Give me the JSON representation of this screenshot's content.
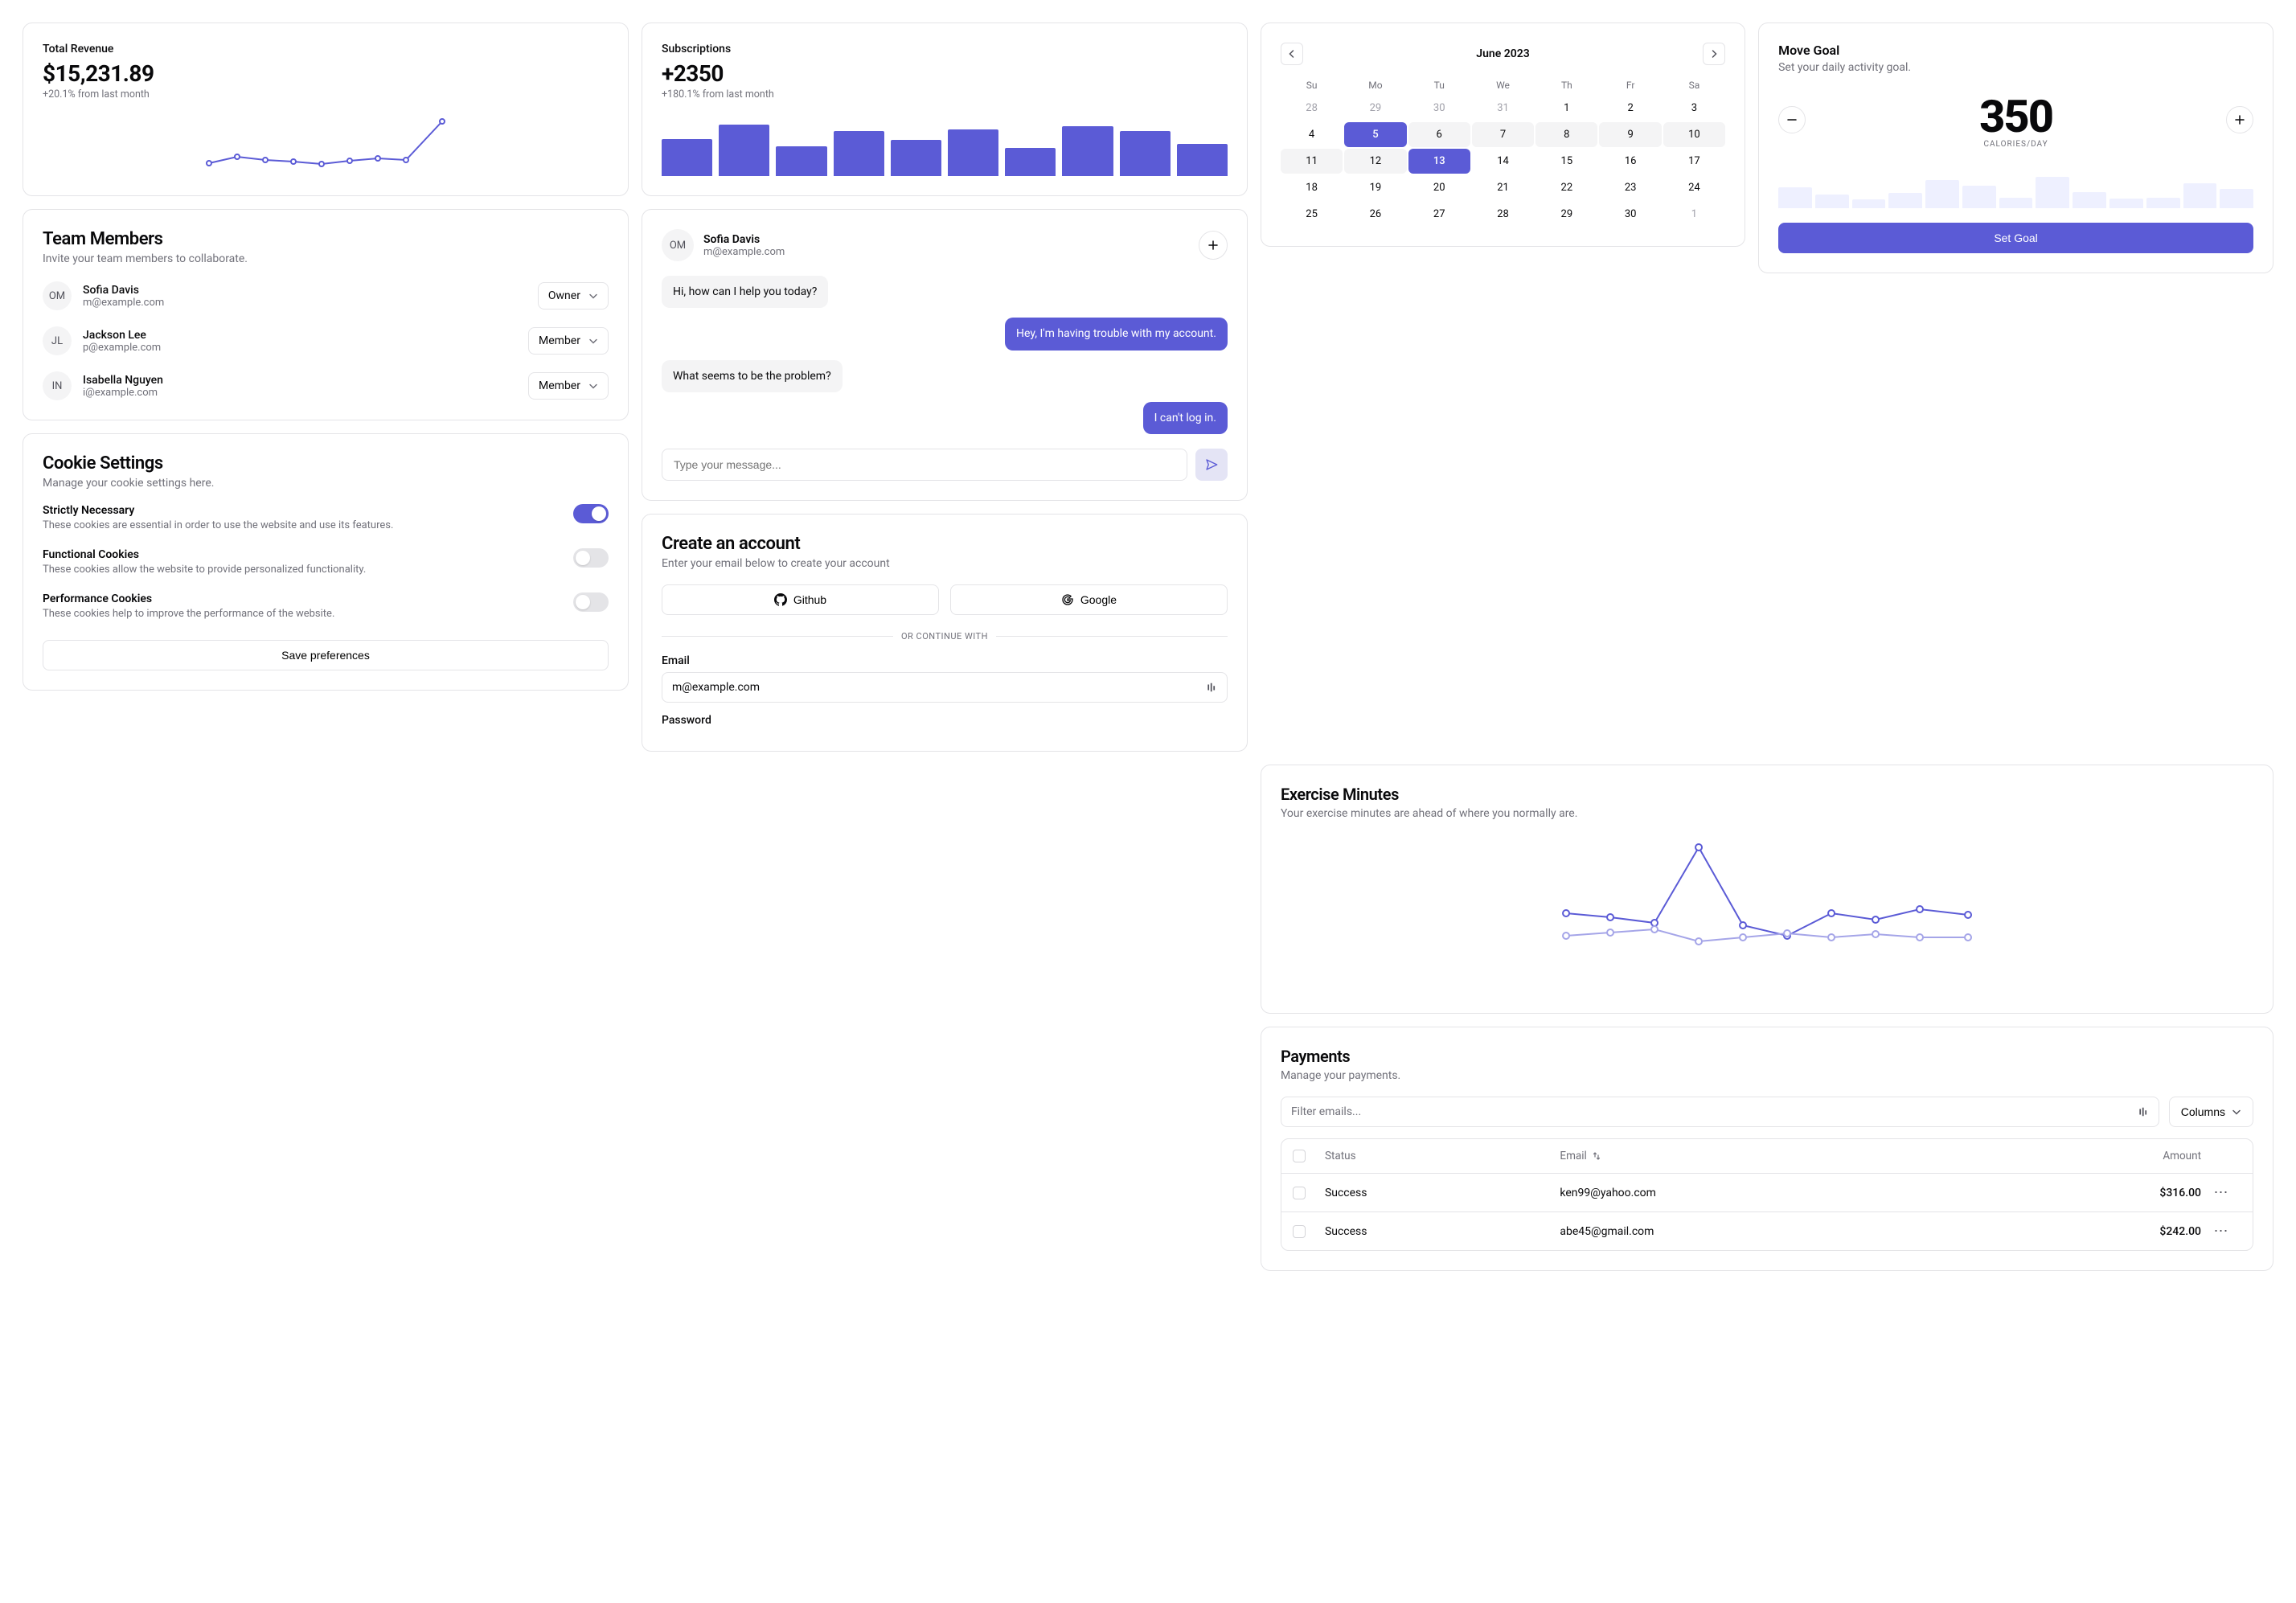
{
  "revenue": {
    "title": "Total Revenue",
    "value": "$15,231.89",
    "change": "+20.1% from last month"
  },
  "subscriptions": {
    "title": "Subscriptions",
    "value": "+2350",
    "change": "+180.1% from last month"
  },
  "team": {
    "title": "Team Members",
    "desc": "Invite your team members to collaborate.",
    "members": [
      {
        "initials": "OM",
        "name": "Sofia Davis",
        "email": "m@example.com",
        "role": "Owner"
      },
      {
        "initials": "JL",
        "name": "Jackson Lee",
        "email": "p@example.com",
        "role": "Member"
      },
      {
        "initials": "IN",
        "name": "Isabella Nguyen",
        "email": "i@example.com",
        "role": "Member"
      }
    ]
  },
  "cookies": {
    "title": "Cookie Settings",
    "desc": "Manage your cookie settings here.",
    "items": [
      {
        "title": "Strictly Necessary",
        "desc": "These cookies are essential in order to use the website and use its features.",
        "on": true
      },
      {
        "title": "Functional Cookies",
        "desc": "These cookies allow the website to provide personalized functionality.",
        "on": false
      },
      {
        "title": "Performance Cookies",
        "desc": "These cookies help to improve the performance of the website.",
        "on": false
      }
    ],
    "save_label": "Save preferences"
  },
  "chat": {
    "initials": "OM",
    "name": "Sofia Davis",
    "email": "m@example.com",
    "messages": [
      {
        "who": "them",
        "text": "Hi, how can I help you today?"
      },
      {
        "who": "me",
        "text": "Hey, I'm having trouble with my account."
      },
      {
        "who": "them",
        "text": "What seems to be the problem?"
      },
      {
        "who": "me",
        "text": "I can't log in."
      }
    ],
    "placeholder": "Type your message..."
  },
  "account": {
    "title": "Create an account",
    "desc": "Enter your email below to create your account",
    "github": "Github",
    "google": "Google",
    "divider": "OR CONTINUE WITH",
    "email_label": "Email",
    "email_value": "m@example.com",
    "password_label": "Password"
  },
  "calendar": {
    "title": "June 2023",
    "dow": [
      "Su",
      "Mo",
      "Tu",
      "We",
      "Th",
      "Fr",
      "Sa"
    ],
    "days": [
      {
        "n": 28,
        "m": true
      },
      {
        "n": 29,
        "m": true
      },
      {
        "n": 30,
        "m": true
      },
      {
        "n": 31,
        "m": true
      },
      {
        "n": 1
      },
      {
        "n": 2
      },
      {
        "n": 3
      },
      {
        "n": 4
      },
      {
        "n": 5,
        "sel": true
      },
      {
        "n": 6,
        "r": true
      },
      {
        "n": 7,
        "r": true
      },
      {
        "n": 8,
        "r": true
      },
      {
        "n": 9,
        "r": true
      },
      {
        "n": 10,
        "r": true
      },
      {
        "n": 11,
        "r": true
      },
      {
        "n": 12,
        "r": true
      },
      {
        "n": 13,
        "sel": true
      },
      {
        "n": 14
      },
      {
        "n": 15
      },
      {
        "n": 16
      },
      {
        "n": 17
      },
      {
        "n": 18
      },
      {
        "n": 19
      },
      {
        "n": 20
      },
      {
        "n": 21
      },
      {
        "n": 22
      },
      {
        "n": 23
      },
      {
        "n": 24
      },
      {
        "n": 25
      },
      {
        "n": 26
      },
      {
        "n": 27
      },
      {
        "n": 28
      },
      {
        "n": 29
      },
      {
        "n": 30
      },
      {
        "n": 1,
        "m": true
      }
    ]
  },
  "goal": {
    "title": "Move Goal",
    "desc": "Set your daily activity goal.",
    "value": "350",
    "unit": "CALORIES/DAY",
    "button": "Set Goal"
  },
  "exercise": {
    "title": "Exercise Minutes",
    "desc": "Your exercise minutes are ahead of where you normally are."
  },
  "payments": {
    "title": "Payments",
    "desc": "Manage your payments.",
    "filter_placeholder": "Filter emails...",
    "columns_label": "Columns",
    "headers": {
      "status": "Status",
      "email": "Email",
      "amount": "Amount"
    },
    "rows": [
      {
        "status": "Success",
        "email": "ken99@yahoo.com",
        "amount": "$316.00"
      },
      {
        "status": "Success",
        "email": "abe45@gmail.com",
        "amount": "$242.00"
      }
    ]
  },
  "chart_data": [
    {
      "type": "line",
      "name": "revenue_sparkline",
      "x": [
        1,
        2,
        3,
        4,
        5,
        6,
        7,
        8,
        9
      ],
      "values": [
        1.0,
        1.3,
        1.1,
        1.0,
        0.9,
        1.05,
        1.1,
        1.05,
        2.0
      ]
    },
    {
      "type": "bar",
      "name": "subscriptions_bars",
      "values": [
        58,
        80,
        46,
        70,
        56,
        72,
        44,
        78,
        70,
        50
      ]
    },
    {
      "type": "bar",
      "name": "move_goal_bars",
      "values": [
        46,
        30,
        20,
        34,
        62,
        50,
        24,
        70,
        36,
        22,
        24,
        56,
        42
      ]
    },
    {
      "type": "line",
      "name": "exercise_minutes",
      "x": [
        1,
        2,
        3,
        4,
        5,
        6,
        7,
        8,
        9,
        10
      ],
      "series": [
        {
          "name": "this_week",
          "values": [
            60,
            58,
            55,
            105,
            55,
            50,
            60,
            56,
            62,
            58
          ]
        },
        {
          "name": "average",
          "values": [
            50,
            52,
            55,
            48,
            50,
            52,
            50,
            52,
            50,
            50
          ]
        }
      ],
      "ylim": [
        0,
        110
      ]
    }
  ]
}
